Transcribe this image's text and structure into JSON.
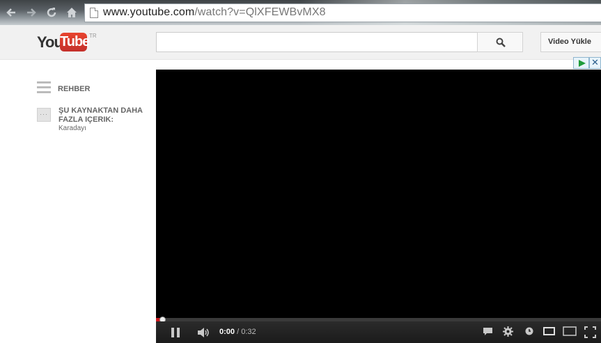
{
  "browser": {
    "url_host": "www.youtube.com",
    "url_path": "/watch?v=QlXFEWBvMX8"
  },
  "header": {
    "logo_you": "You",
    "logo_tube": "Tube",
    "logo_region": "TR",
    "search_placeholder": "",
    "upload_label": "Video Yükle"
  },
  "sidebar": {
    "guide_label": "REHBER",
    "more_from_title": "ŞU KAYNAKTAN DAHA FAZLA IÇERIK:",
    "more_from_channel": "Karadayı"
  },
  "player": {
    "current_time": "0:00",
    "separator": " / ",
    "duration": "0:32",
    "progress_fraction": 0.01
  },
  "icons": [
    "back-icon",
    "forward-icon",
    "reload-icon",
    "home-icon",
    "page-icon",
    "search-icon",
    "menu-icon",
    "more-icon",
    "ad-play-icon",
    "ad-close-icon",
    "pause-icon",
    "volume-icon",
    "captions-icon",
    "settings-icon",
    "watch-later-icon",
    "small-player-icon",
    "large-player-icon",
    "fullscreen-icon"
  ]
}
